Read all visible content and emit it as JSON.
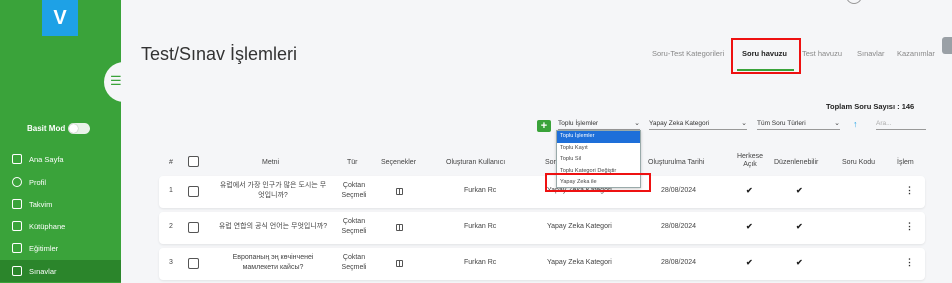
{
  "sidebar": {
    "logo_letter": "V",
    "basit_mod_label": "Basit Mod",
    "items": [
      {
        "label": "Ana Sayfa"
      },
      {
        "label": "Profil"
      },
      {
        "label": "Takvim"
      },
      {
        "label": "Kütüphane"
      },
      {
        "label": "Eğitimler"
      },
      {
        "label": "Sınavlar"
      }
    ]
  },
  "header": {
    "title": "Test/Sınav İşlemleri",
    "tabs": [
      {
        "label": "Soru-Test Kategorileri"
      },
      {
        "label": "Soru havuzu"
      },
      {
        "label": "Test havuzu"
      },
      {
        "label": "Sınavlar"
      },
      {
        "label": "Kazanımlar"
      }
    ],
    "active_tab": "Soru havuzu"
  },
  "summary": {
    "total_label": "Toplam Soru Sayısı : 146"
  },
  "toolbar": {
    "add_label": "+",
    "bulk_select": "Toplu İşlemler",
    "category_select": "Yapay Zeka Kategori",
    "type_select": "Tüm Soru Türleri",
    "search_placeholder": "Ara..."
  },
  "bulk_dropdown": {
    "options": [
      {
        "label": "Toplu İşlemler"
      },
      {
        "label": "Toplu Kayıt"
      },
      {
        "label": "Toplu Sil"
      },
      {
        "label": "Toplu Kategori Değiştir"
      },
      {
        "label": "Yapay Zeka ile"
      }
    ],
    "selected": "Toplu İşlemler"
  },
  "table": {
    "columns": {
      "index": "#",
      "text": "Metni",
      "type": "Tür",
      "options": "Seçenekler",
      "creator": "Oluşturan Kullanıcı",
      "category": "Soru Kategorisi",
      "created": "Oluşturulma Tarihi",
      "public": "Herkese Açık",
      "editable": "Düzenlenebilir",
      "code": "Soru Kodu",
      "action": "İşlem"
    },
    "rows": [
      {
        "index": "1",
        "text_line1": "유럽에서 가장 인구가 많은 도시는 무",
        "text_line2": "엇입니까?",
        "type_line1": "Çoktan",
        "type_line2": "Seçmeli",
        "creator": "Furkan Rc",
        "category": "Yapay Zeka Kategori",
        "created": "28/08/2024"
      },
      {
        "index": "2",
        "text_line1": "유럽 연합의 공식 언어는 무엇입니까?",
        "text_line2": "",
        "type_line1": "Çoktan",
        "type_line2": "Seçmeli",
        "creator": "Furkan Rc",
        "category": "Yapay Zeka Kategori",
        "created": "28/08/2024"
      },
      {
        "index": "3",
        "text_line1": "Европаның эң көчінченеі",
        "text_line2": "мамлекети кайсы?",
        "type_line1": "Çoktan",
        "type_line2": "Seçmeli",
        "creator": "Furkan Rc",
        "category": "Yapay Zeka Kategori",
        "created": "28/08/2024"
      }
    ]
  },
  "colors": {
    "sidebar": "#3aa33a",
    "logo": "#1ea1e6",
    "highlight": "#ee1111",
    "dropdown_selected": "#1e6fd9"
  }
}
